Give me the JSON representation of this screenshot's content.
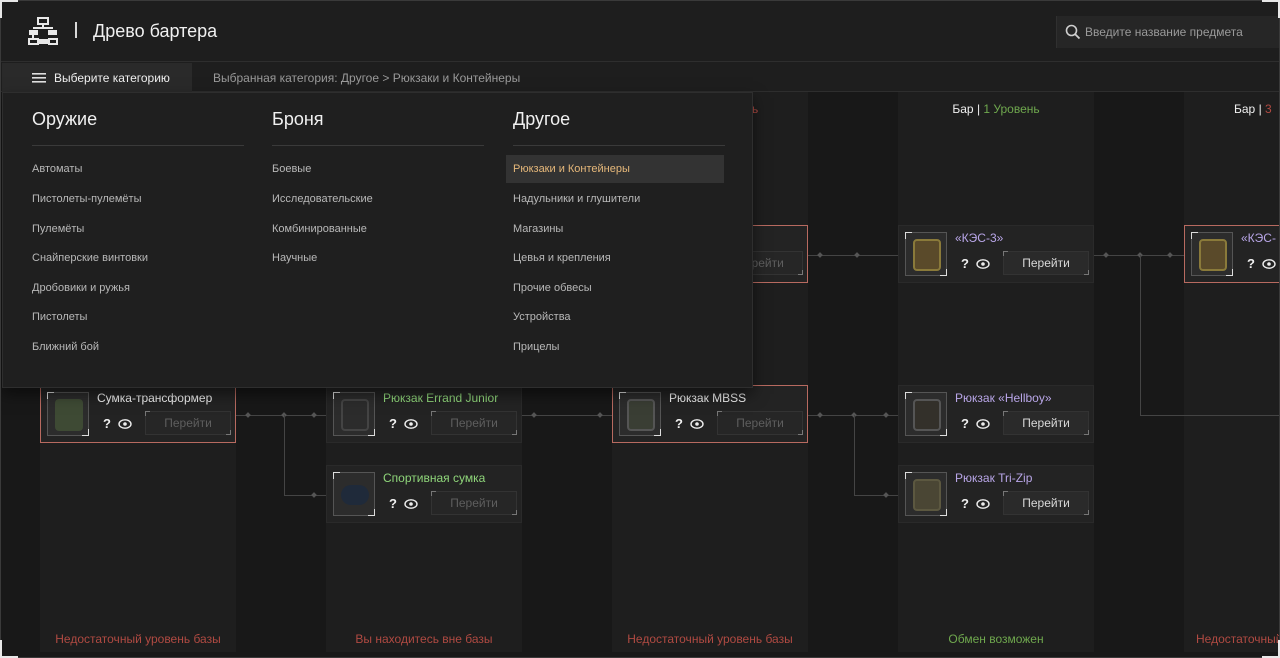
{
  "header": {
    "title": "Древо бартера",
    "search_placeholder": "Введите название предмета"
  },
  "subbar": {
    "category_button": "Выберите категорию",
    "breadcrumb": "Выбранная категория: Другое > Рюкзаки и Контейнеры"
  },
  "dropdown": {
    "columns": [
      {
        "heading": "Оружие",
        "items": [
          "Автоматы",
          "Пистолеты-пулемёты",
          "Пулемёты",
          "Снайперские винтовки",
          "Дробовики и ружья",
          "Пистолеты",
          "Ближний бой"
        ]
      },
      {
        "heading": "Броня",
        "items": [
          "Боевые",
          "Исследовательские",
          "Комбинированные",
          "Научные"
        ]
      },
      {
        "heading": "Другое",
        "items": [
          "Рюкзаки и Контейнеры",
          "Надульники и глушители",
          "Магазины",
          "Цевья и крепления",
          "Прочие обвесы",
          "Устройства",
          "Прицелы"
        ],
        "active_index": 0
      }
    ]
  },
  "tree": {
    "columns": [
      {
        "label_partial": "ь",
        "footer": "Недостаточный уровень базы"
      },
      {
        "footer": "Вы находитесь вне базы"
      },
      {
        "footer": "Недостаточный уровень базы"
      },
      {
        "label_bar": "Бар",
        "label_level": "1 Уровень",
        "footer": "Обмен возможен"
      },
      {
        "label_bar": "Бар",
        "label_level": "3",
        "footer": "Недостаточный"
      }
    ],
    "cards": {
      "transformer": {
        "name": "Сумка-трансформер",
        "q": "?",
        "go": "Перейти"
      },
      "errand": {
        "name": "Рюкзак Errand Junior",
        "q": "?",
        "go": "Перейти"
      },
      "sport": {
        "name": "Спортивная сумка",
        "q": "?",
        "go": "Перейти"
      },
      "mbss": {
        "name": "Рюкзак MBSS",
        "q": "?",
        "go": "Перейти"
      },
      "mid_top": {
        "go": "Перейти"
      },
      "kes3": {
        "name": "«КЭС-3»",
        "q": "?",
        "go": "Перейти"
      },
      "hellboy": {
        "name": "Рюкзак «Hellboy»",
        "q": "?",
        "go": "Перейти"
      },
      "trizip": {
        "name": "Рюкзак Tri-Zip",
        "q": "?",
        "go": "Перейти"
      },
      "kes_right": {
        "name": "«КЭС-",
        "q": "?"
      }
    }
  },
  "colors": {
    "accent_active": "#e6b87a",
    "warning": "#b04a42",
    "ok": "#6fa84e",
    "item_green": "#8fd67a",
    "item_purple": "#b9a6e8",
    "highlight_border": "#b86a60"
  }
}
